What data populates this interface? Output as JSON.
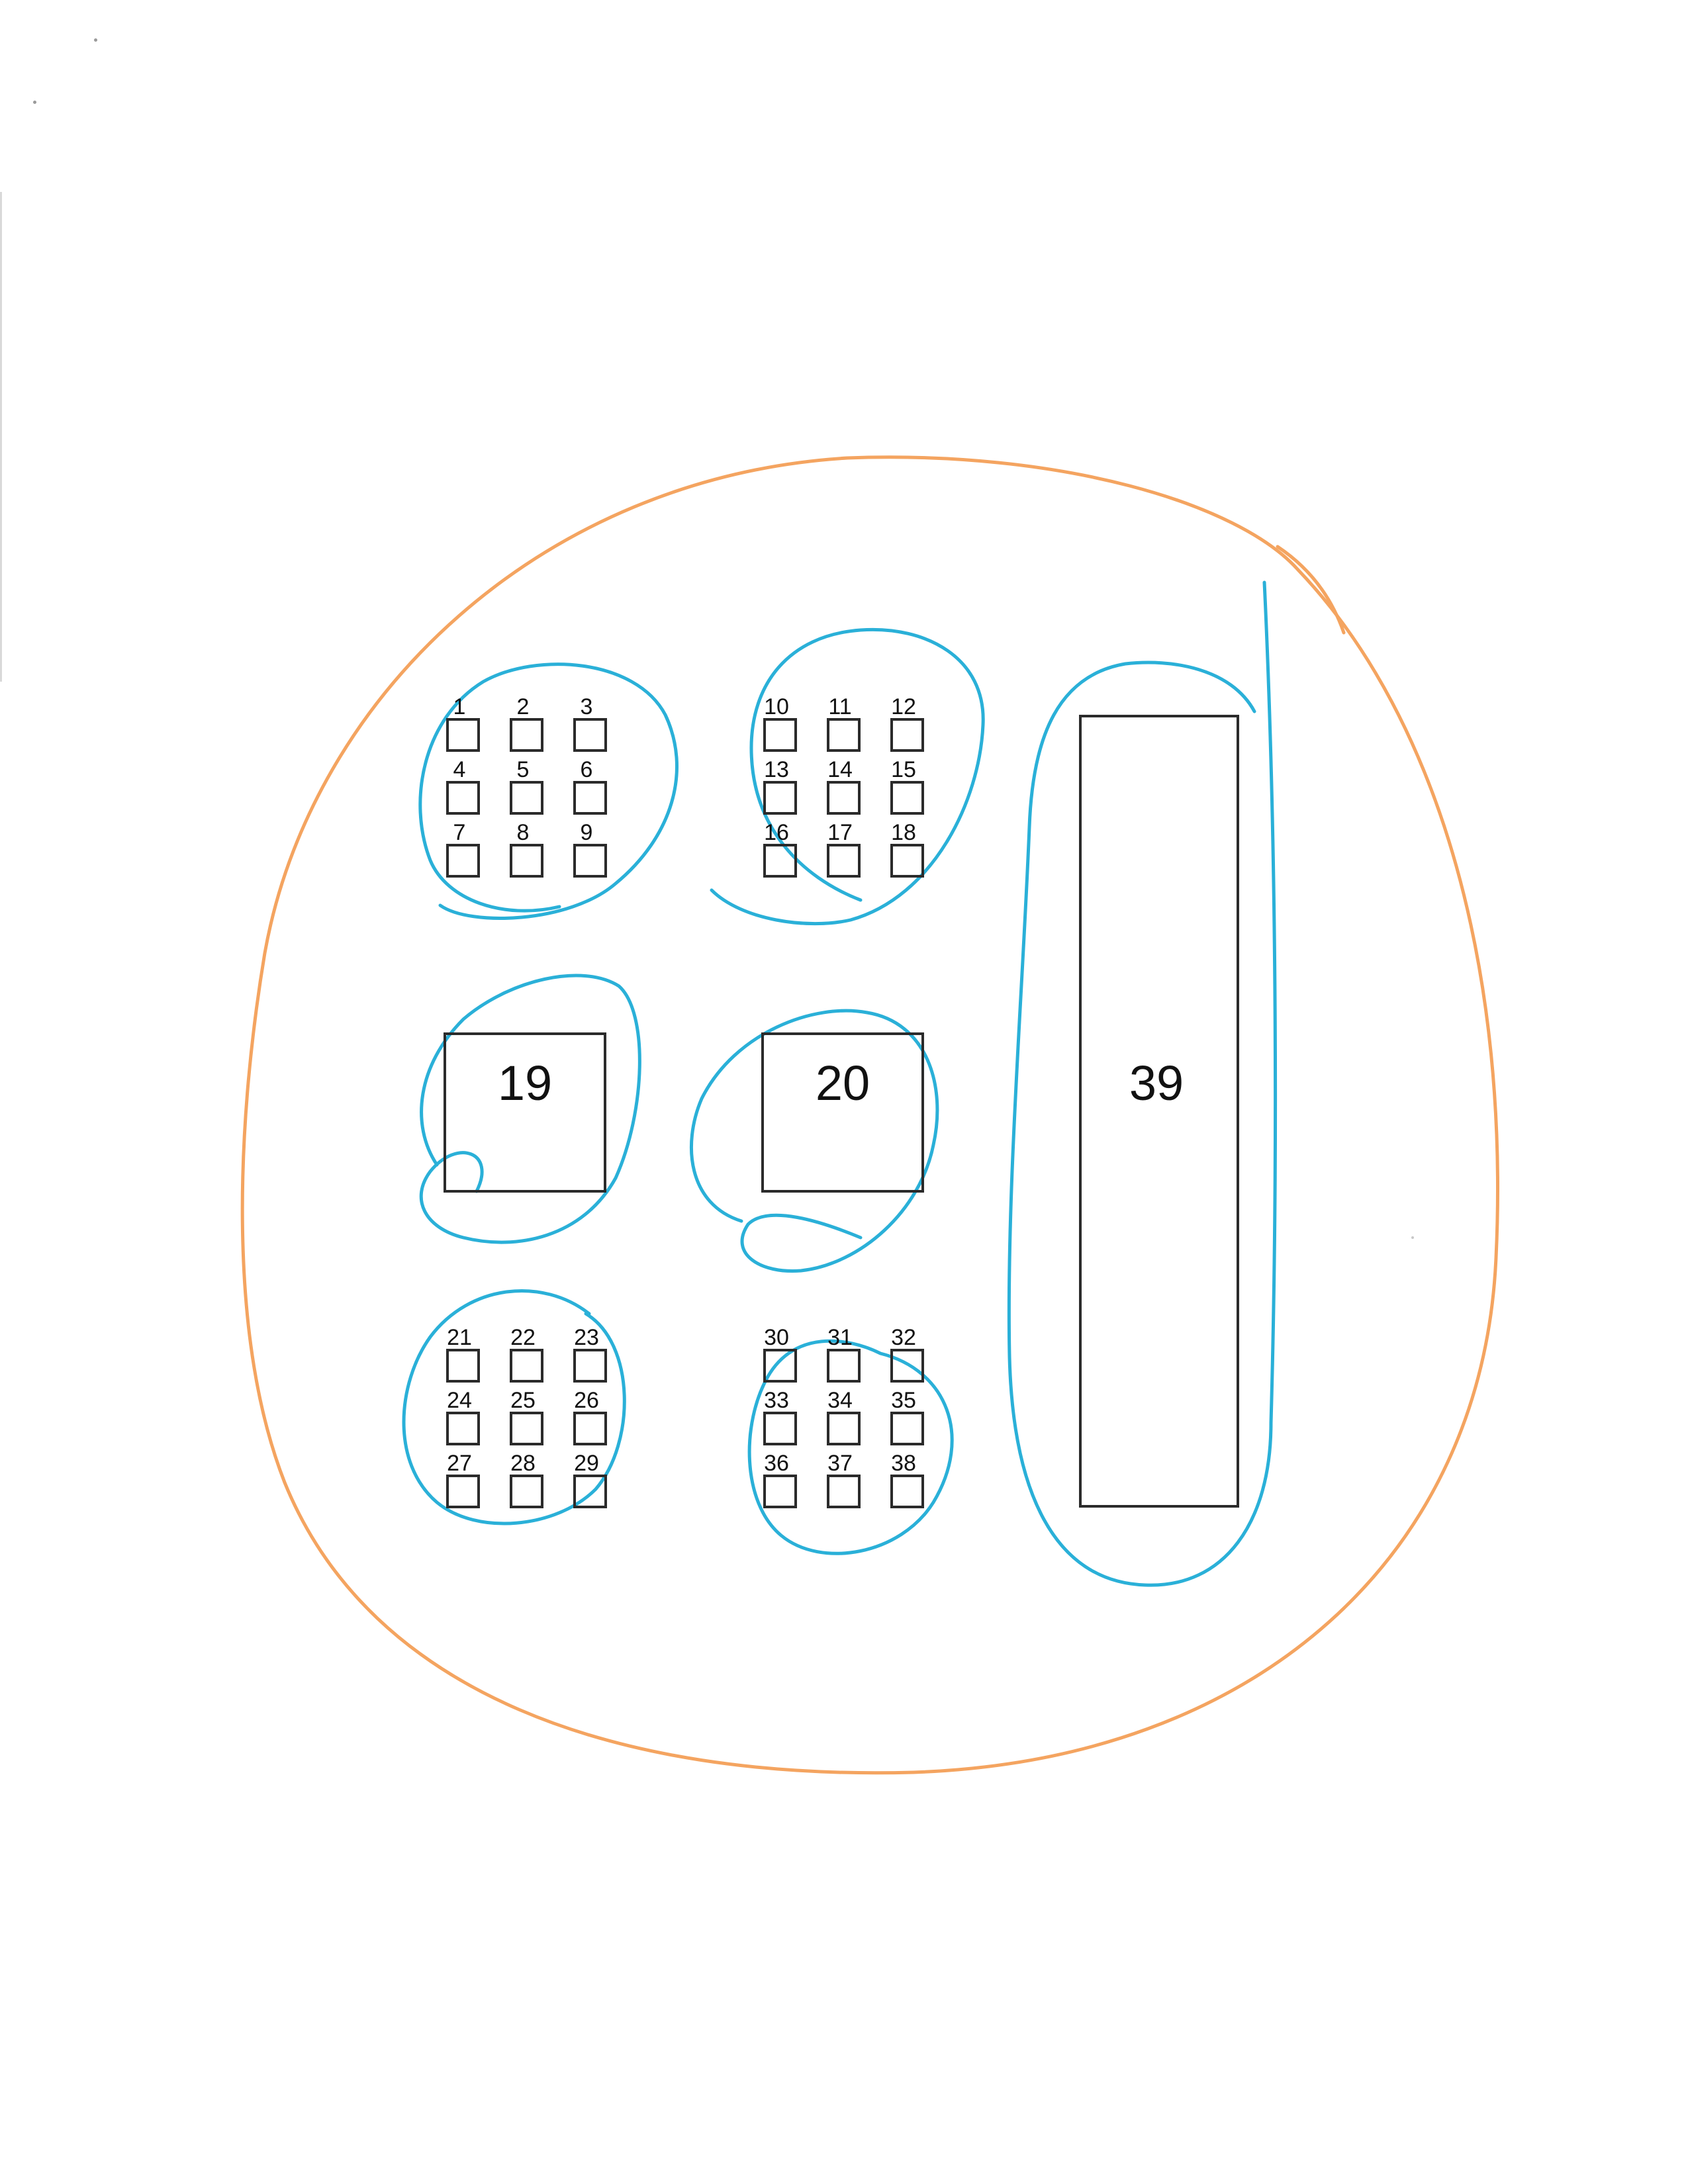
{
  "diagram": {
    "small_boxes": {
      "group_1": [
        "1",
        "2",
        "3",
        "4",
        "5",
        "6",
        "7",
        "8",
        "9"
      ],
      "group_2": [
        "10",
        "11",
        "12",
        "13",
        "14",
        "15",
        "16",
        "17",
        "18"
      ],
      "group_3": [
        "21",
        "22",
        "23",
        "24",
        "25",
        "26",
        "27",
        "28",
        "29"
      ],
      "group_4": [
        "30",
        "31",
        "32",
        "33",
        "34",
        "35",
        "36",
        "37",
        "38"
      ]
    },
    "large_boxes": {
      "box_19": "19",
      "box_20": "20",
      "box_39": "39"
    }
  },
  "colors": {
    "outer_loop": "#f4a460",
    "inner_loops": "#2ab0d8",
    "box_stroke": "#2b2b2b"
  }
}
